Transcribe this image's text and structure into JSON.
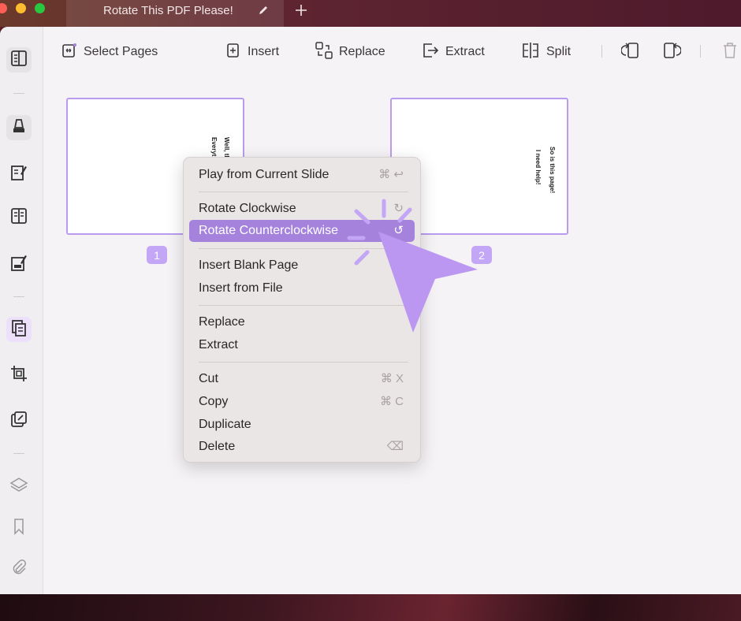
{
  "window": {
    "tab_title": "Rotate This PDF Please!"
  },
  "toolbar": {
    "select_pages": "Select Pages",
    "insert": "Insert",
    "replace": "Replace",
    "extract": "Extract",
    "split": "Split"
  },
  "pages": [
    {
      "number": "1",
      "text_lines": [
        "Well, thi",
        "Everythi"
      ]
    },
    {
      "number": "2",
      "text_lines": [
        "So is this page!",
        "I need help!"
      ]
    }
  ],
  "context_menu": {
    "play_from_current_slide": {
      "label": "Play from Current Slide",
      "shortcut": "⌘ ↩"
    },
    "rotate_clockwise": {
      "label": "Rotate Clockwise",
      "shortcut": "↻"
    },
    "rotate_counterclockwise": {
      "label": "Rotate Counterclockwise",
      "shortcut": "↺"
    },
    "insert_blank_page": {
      "label": "Insert Blank Page"
    },
    "insert_from_file": {
      "label": "Insert from File"
    },
    "replace": {
      "label": "Replace"
    },
    "extract": {
      "label": "Extract"
    },
    "cut": {
      "label": "Cut",
      "shortcut": "⌘ X"
    },
    "copy": {
      "label": "Copy",
      "shortcut": "⌘ C"
    },
    "duplicate": {
      "label": "Duplicate"
    },
    "delete": {
      "label": "Delete",
      "shortcut": "⌫"
    }
  },
  "colors": {
    "accent": "#a583dc",
    "page_border": "#b99cf0",
    "badge": "#c3a6f5"
  }
}
